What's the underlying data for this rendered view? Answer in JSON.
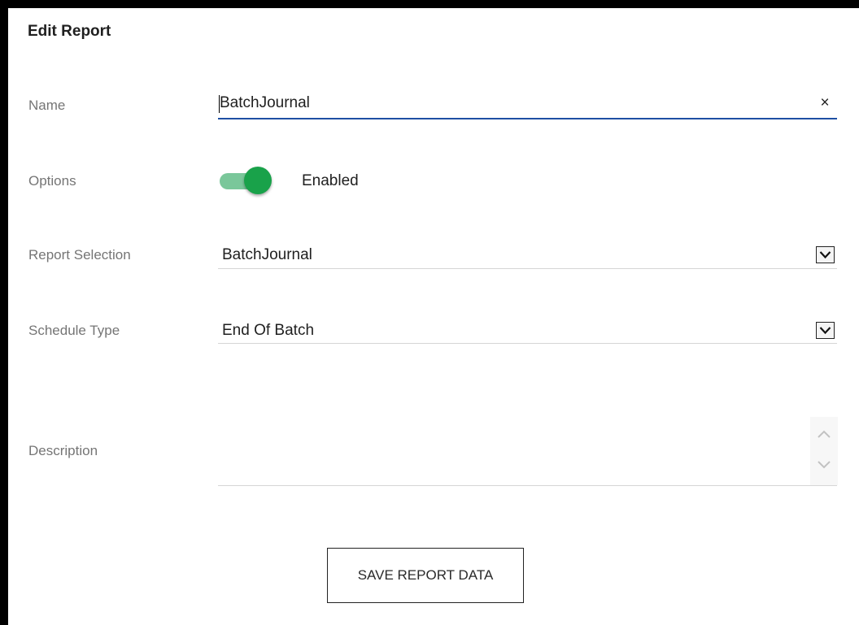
{
  "dialog": {
    "title": "Edit Report"
  },
  "fields": {
    "name": {
      "label": "Name",
      "value": "BatchJournal",
      "clear_icon": "close-icon",
      "clear_glyph": "×"
    },
    "options": {
      "label": "Options",
      "toggle_state": "on",
      "toggle_text": "Enabled"
    },
    "report_selection": {
      "label": "Report Selection",
      "value": "BatchJournal",
      "dropdown_icon": "chevron-down-icon"
    },
    "schedule_type": {
      "label": "Schedule Type",
      "value": "End Of Batch",
      "dropdown_icon": "chevron-down-icon"
    },
    "description": {
      "label": "Description",
      "value": "",
      "scroll_up_icon": "chevron-up-icon",
      "scroll_down_icon": "chevron-down-icon"
    }
  },
  "actions": {
    "save_label": "SAVE REPORT DATA"
  },
  "colors": {
    "accent_underline": "#1e4fa3",
    "toggle_track": "#7ac79a",
    "toggle_knob": "#19a24a",
    "label_text": "#757575"
  }
}
